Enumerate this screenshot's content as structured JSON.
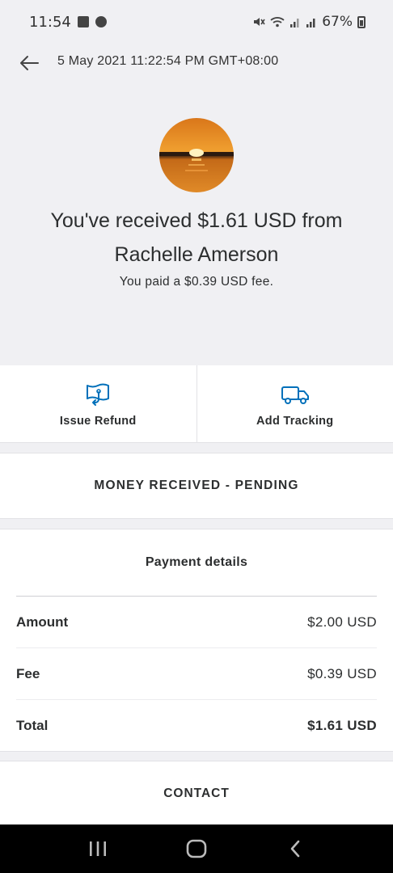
{
  "status_bar": {
    "time": "11:54",
    "battery": "67%"
  },
  "header": {
    "date": "5 May 2021 11:22:54 PM GMT+08:00"
  },
  "transaction": {
    "title_line1": "You've received $1.61 USD from",
    "title_line2": "Rachelle Amerson",
    "fee_note": "You paid a $0.39 USD fee."
  },
  "actions": [
    {
      "label": "Issue Refund",
      "icon": "refund-icon"
    },
    {
      "label": "Add Tracking",
      "icon": "truck-icon"
    }
  ],
  "status": {
    "text": "MONEY RECEIVED - PENDING"
  },
  "payment_details": {
    "title": "Payment details",
    "rows": [
      {
        "label": "Amount",
        "value": "$2.00 USD"
      },
      {
        "label": "Fee",
        "value": "$0.39 USD"
      },
      {
        "label": "Total",
        "value": "$1.61 USD"
      }
    ]
  },
  "contact": {
    "label": "CONTACT"
  },
  "colors": {
    "accent": "#0070ba",
    "background": "#f0f0f3",
    "card": "#ffffff"
  }
}
